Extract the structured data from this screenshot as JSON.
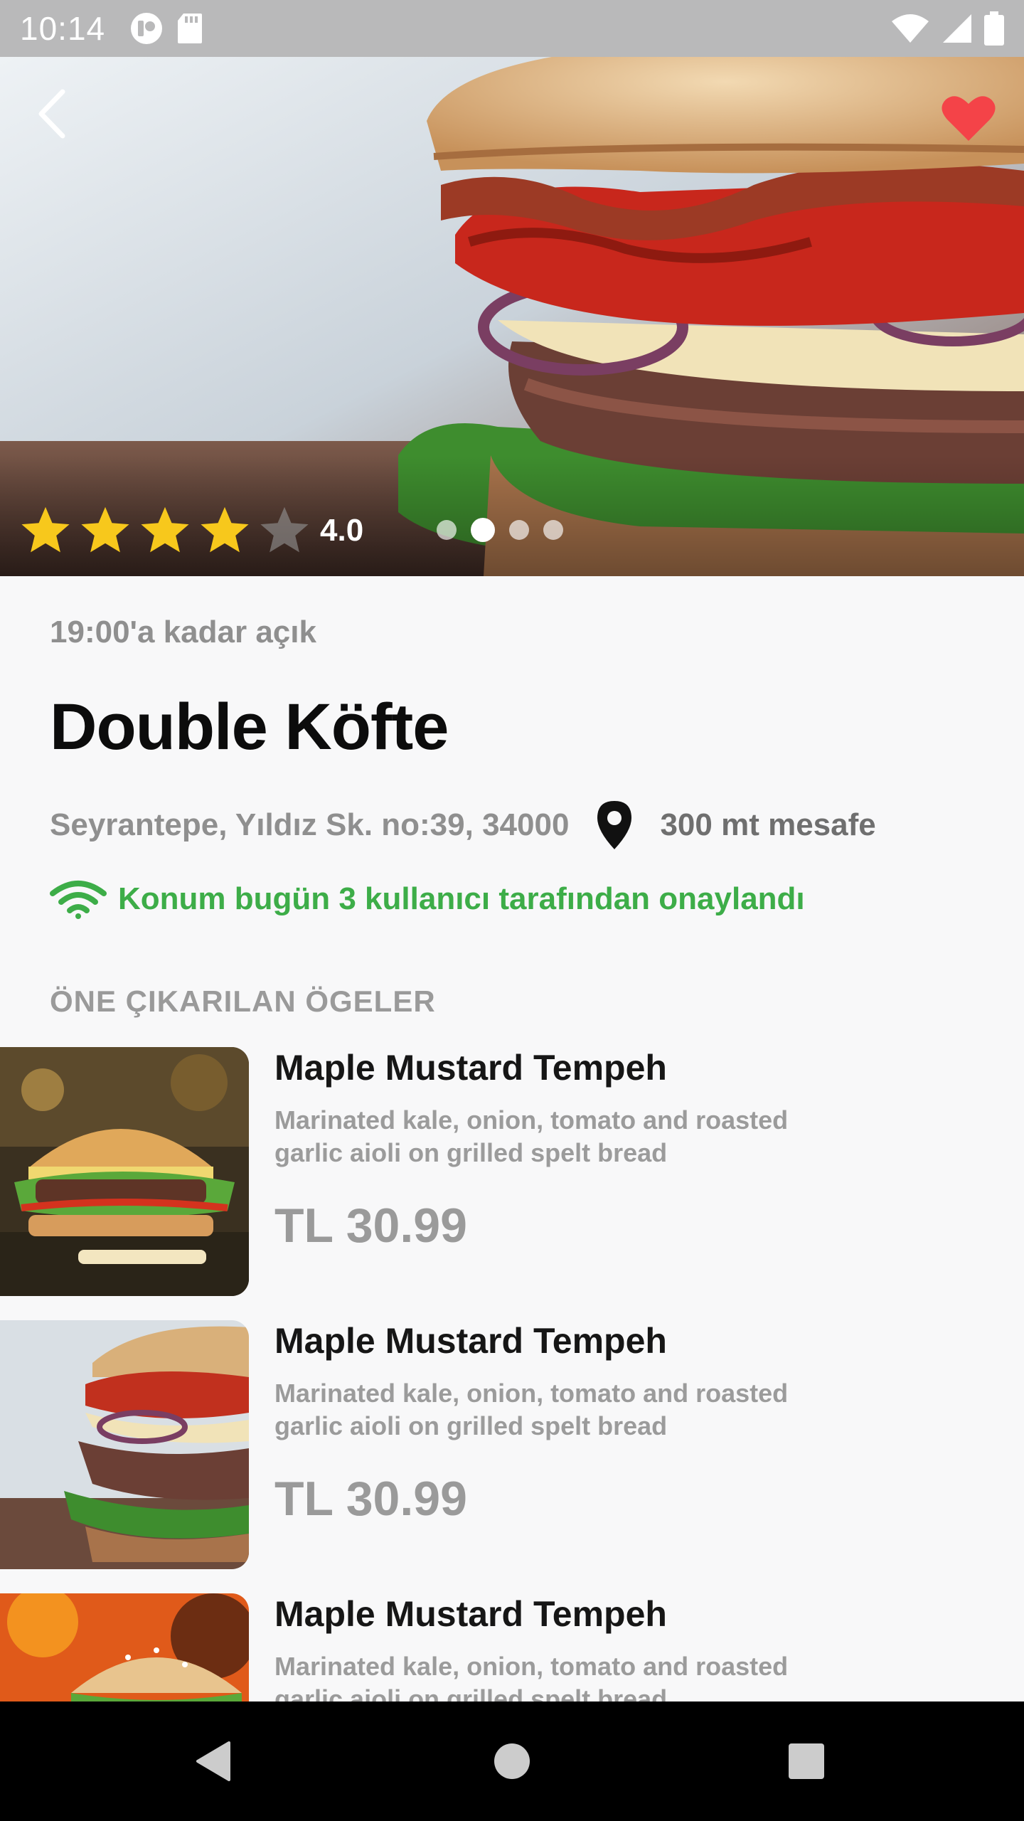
{
  "status_bar": {
    "time": "10:14",
    "icons": [
      "notification-app-icon",
      "sd-card-icon",
      "wifi-icon",
      "cell-signal-icon",
      "battery-icon"
    ]
  },
  "hero": {
    "rating_value": "4.0",
    "rating": 4,
    "rating_max": 5,
    "carousel_index": 1,
    "carousel_count": 4,
    "favorited": true
  },
  "place": {
    "open_hours": "19:00'a kadar açık",
    "name": "Double Köfte",
    "address": "Seyrantepe, Yıldız Sk. no:39, 34000",
    "distance": "300 mt mesafe",
    "verification": "Konum bugün 3 kullanıcı tarafından onaylandı"
  },
  "featured": {
    "title": "ÖNE ÇIKARILAN ÖGELER",
    "items": [
      {
        "name": "Maple Mustard Tempeh",
        "description": "Marinated kale, onion, tomato and roasted garlic aioli on grilled spelt bread",
        "price": "TL 30.99"
      },
      {
        "name": "Maple Mustard Tempeh",
        "description": "Marinated kale, onion, tomato and roasted garlic aioli on grilled spelt bread",
        "price": "TL 30.99"
      },
      {
        "name": "Maple Mustard Tempeh",
        "description": "Marinated kale, onion, tomato and roasted garlic aioli on grilled spelt bread",
        "price": ""
      }
    ]
  },
  "colors": {
    "accent_green": "#3dad48",
    "star_yellow": "#f7c81c",
    "heart_red": "#f44348",
    "muted_text": "#8f8f8f"
  }
}
